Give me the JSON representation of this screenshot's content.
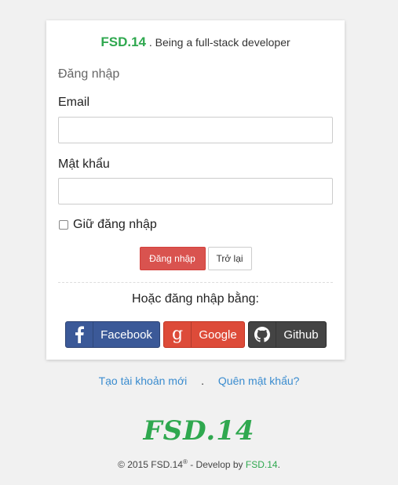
{
  "header": {
    "brand": "FSD.14",
    "tagline": ". Being a full-stack developer"
  },
  "form": {
    "title": "Đăng nhập",
    "email_label": "Email",
    "email_value": "",
    "password_label": "Mật khẩu",
    "password_value": "",
    "remember_label": "Giữ đăng nhập",
    "remember_checked": false,
    "login_button": "Đăng nhập",
    "back_button": "Trở lại"
  },
  "social": {
    "heading": "Hoặc đăng nhập bằng:",
    "facebook": "Facebook",
    "google": "Google",
    "github": "Github"
  },
  "links": {
    "register": "Tạo tài khoản mới",
    "separator": ".",
    "forgot": "Quên mật khẩu?"
  },
  "footer": {
    "logo": "FSD.14",
    "copyright": "© 2015 FSD.14",
    "reg_mark": "®",
    "develop_by": " - Develop by ",
    "developer": "FSD.14",
    "end": "."
  },
  "colors": {
    "brand_green": "#2fa84f",
    "login_red": "#d9534f",
    "facebook_blue": "#3b5998",
    "google_red": "#dd4b39",
    "github_dark": "#444444",
    "link_blue": "#3a8ccf"
  }
}
